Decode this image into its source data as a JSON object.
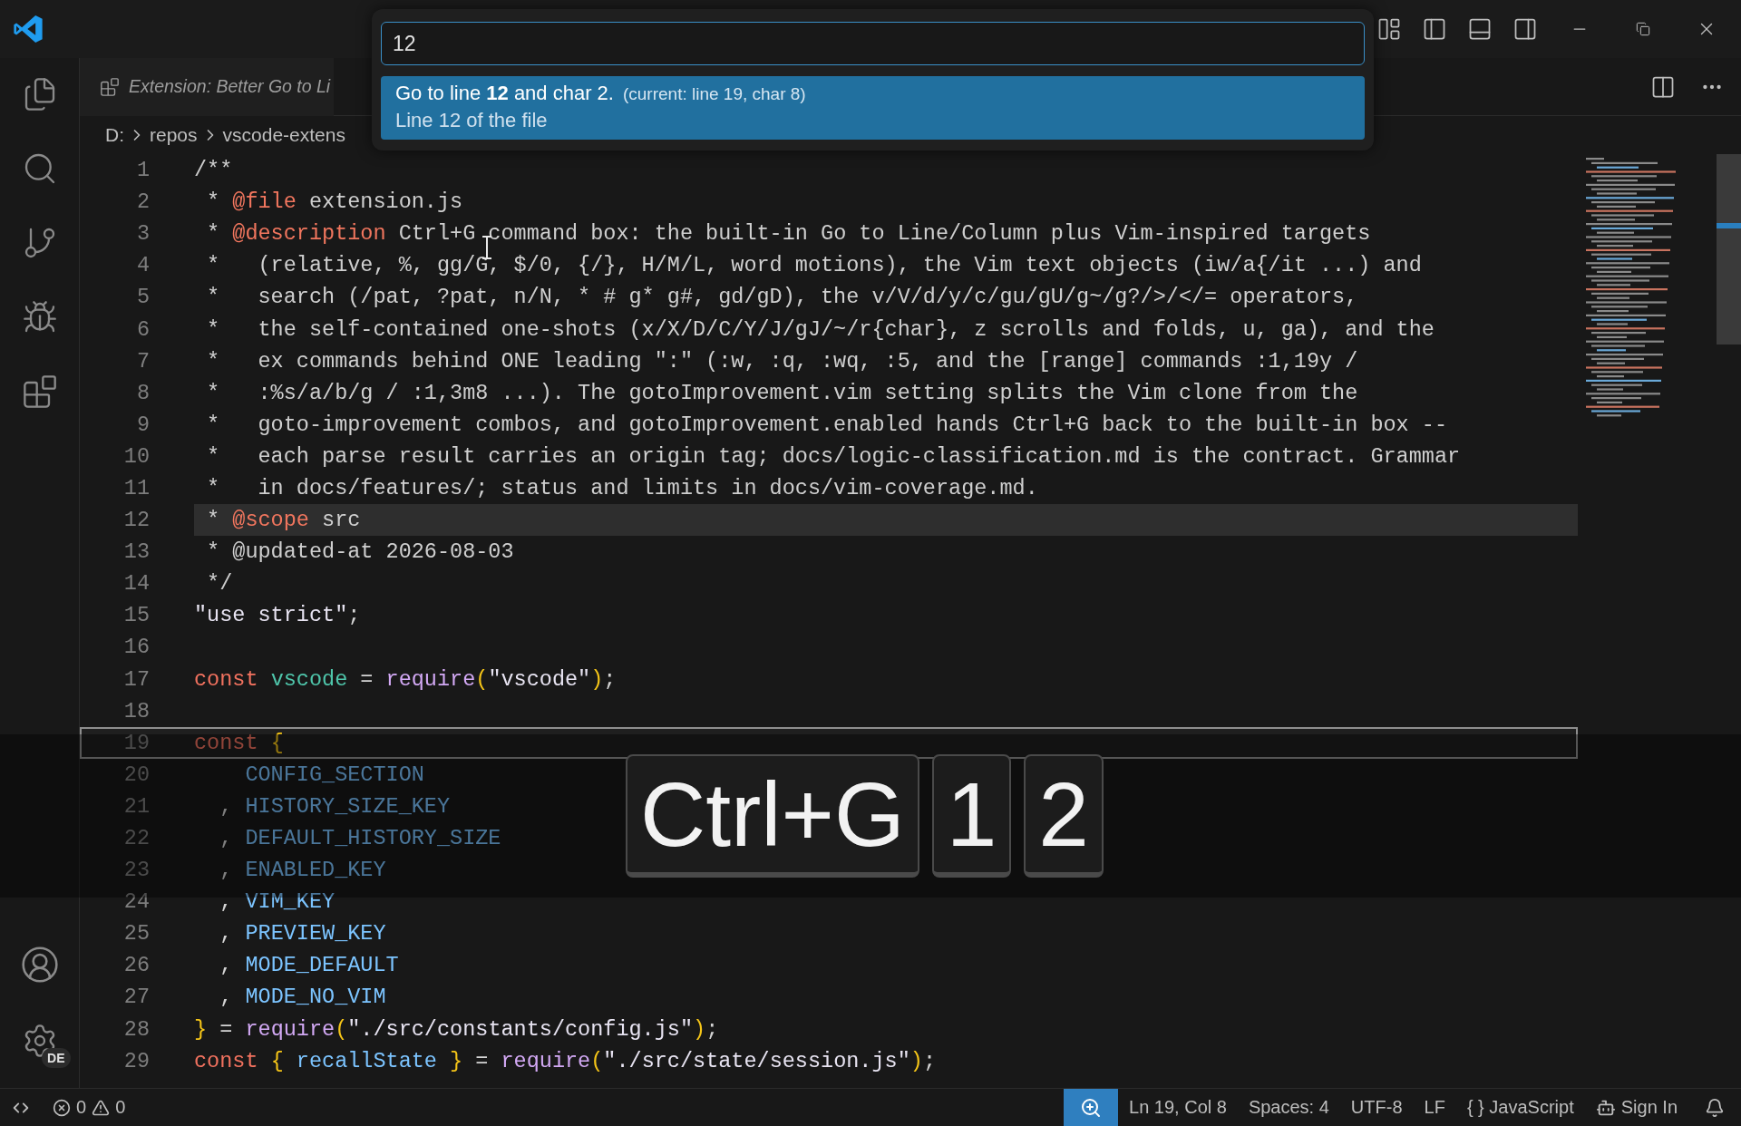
{
  "activity_bar": {
    "account_badge": "DE"
  },
  "tab": {
    "title": "Extension: Better Go to Li"
  },
  "breadcrumb": [
    "D:",
    "repos",
    "vscode-extens"
  ],
  "quick_input": {
    "value": "12",
    "items": [
      {
        "label": "Go to line **12** and char 2.",
        "detail": "(current: line 19, char 8)",
        "description": "Line 12 of the file",
        "selected": true
      }
    ]
  },
  "editor": {
    "lines": [
      {
        "number": "1",
        "highlighted": false,
        "cursor": false,
        "tokens": [
          {
            "kind": "comment",
            "text": "/**"
          }
        ]
      },
      {
        "number": "2",
        "highlighted": false,
        "cursor": false,
        "tokens": [
          {
            "kind": "comment",
            "text": " * "
          },
          {
            "kind": "tag",
            "text": "@file"
          },
          {
            "kind": "comment",
            "text": " extension.js"
          }
        ]
      },
      {
        "number": "3",
        "highlighted": false,
        "cursor": false,
        "tokens": [
          {
            "kind": "comment",
            "text": " * "
          },
          {
            "kind": "tag",
            "text": "@description"
          },
          {
            "kind": "comment",
            "text": " Ctrl+G command box: the built-in Go to Line/Column plus Vim-inspired targets"
          }
        ]
      },
      {
        "number": "4",
        "highlighted": false,
        "cursor": false,
        "tokens": [
          {
            "kind": "comment",
            "text": " *   (relative, %, gg/G, $/0, {/}, H/M/L, word motions), the Vim text objects (iw/a{/it ...) and"
          }
        ]
      },
      {
        "number": "5",
        "highlighted": false,
        "cursor": false,
        "tokens": [
          {
            "kind": "comment",
            "text": " *   search (/pat, ?pat, n/N, * # g* g#, gd/gD), the v/V/d/y/c/gu/gU/g~/g?/>/</= operators,"
          }
        ]
      },
      {
        "number": "6",
        "highlighted": false,
        "cursor": false,
        "tokens": [
          {
            "kind": "comment",
            "text": " *   the self-contained one-shots (x/X/D/C/Y/J/gJ/~/r{char}, z scrolls and folds, u, ga), and the"
          }
        ]
      },
      {
        "number": "7",
        "highlighted": false,
        "cursor": false,
        "tokens": [
          {
            "kind": "comment",
            "text": " *   ex commands behind ONE leading \":\" (:w, :q, :wq, :5, and the [range] commands :1,19y /"
          }
        ]
      },
      {
        "number": "8",
        "highlighted": false,
        "cursor": false,
        "tokens": [
          {
            "kind": "comment",
            "text": " *   :%s/a/b/g / :1,3m8 ...). The gotoImprovement.vim setting splits the Vim clone from the"
          }
        ]
      },
      {
        "number": "9",
        "highlighted": false,
        "cursor": false,
        "tokens": [
          {
            "kind": "comment",
            "text": " *   goto-improvement combos, and gotoImprovement.enabled hands Ctrl+G back to the built-in box --"
          }
        ]
      },
      {
        "number": "10",
        "highlighted": false,
        "cursor": false,
        "tokens": [
          {
            "kind": "comment",
            "text": " *   each parse result carries an origin tag; docs/logic-classification.md is the contract. Grammar"
          }
        ]
      },
      {
        "number": "11",
        "highlighted": false,
        "cursor": false,
        "tokens": [
          {
            "kind": "comment",
            "text": " *   in docs/features/; status and limits in docs/vim-coverage.md."
          }
        ]
      },
      {
        "number": "12",
        "highlighted": true,
        "cursor": false,
        "tokens": [
          {
            "kind": "comment",
            "text": " * "
          },
          {
            "kind": "tag",
            "text": "@scope"
          },
          {
            "kind": "comment",
            "text": " src"
          }
        ]
      },
      {
        "number": "13",
        "highlighted": false,
        "cursor": false,
        "tokens": [
          {
            "kind": "comment",
            "text": " * @updated-at 2026-08-03"
          }
        ]
      },
      {
        "number": "14",
        "highlighted": false,
        "cursor": false,
        "tokens": [
          {
            "kind": "comment",
            "text": " */"
          }
        ]
      },
      {
        "number": "15",
        "highlighted": false,
        "cursor": false,
        "tokens": [
          {
            "kind": "string",
            "text": "\"use strict\""
          },
          {
            "kind": "punct",
            "text": ";"
          }
        ]
      },
      {
        "number": "16",
        "highlighted": false,
        "cursor": false
      },
      {
        "number": "17",
        "highlighted": false,
        "cursor": false,
        "tokens": [
          {
            "kind": "keyword",
            "text": "const "
          },
          {
            "kind": "variable",
            "text": "vscode"
          },
          {
            "kind": "punct",
            "text": " = "
          },
          {
            "kind": "function",
            "text": "require"
          },
          {
            "kind": "brace",
            "text": "("
          },
          {
            "kind": "string",
            "text": "\"vscode\""
          },
          {
            "kind": "brace",
            "text": ")"
          },
          {
            "kind": "punct",
            "text": ";"
          }
        ]
      },
      {
        "number": "18",
        "highlighted": false,
        "cursor": false
      },
      {
        "number": "19",
        "highlighted": false,
        "cursor": true,
        "tokens": [
          {
            "kind": "keyword",
            "text": "const "
          },
          {
            "kind": "brace",
            "text": "{"
          }
        ]
      },
      {
        "number": "20",
        "highlighted": false,
        "cursor": false,
        "tokens": [
          {
            "kind": "constant",
            "text": "    CONFIG_SECTION"
          }
        ]
      },
      {
        "number": "21",
        "highlighted": false,
        "cursor": false,
        "tokens": [
          {
            "kind": "punct",
            "text": "  , "
          },
          {
            "kind": "constant",
            "text": "HISTORY_SIZE_KEY"
          }
        ]
      },
      {
        "number": "22",
        "highlighted": false,
        "cursor": false,
        "tokens": [
          {
            "kind": "punct",
            "text": "  , "
          },
          {
            "kind": "constant",
            "text": "DEFAULT_HISTORY_SIZE"
          }
        ]
      },
      {
        "number": "23",
        "highlighted": false,
        "cursor": false,
        "tokens": [
          {
            "kind": "punct",
            "text": "  , "
          },
          {
            "kind": "constant",
            "text": "ENABLED_KEY"
          }
        ]
      },
      {
        "number": "24",
        "highlighted": false,
        "cursor": false,
        "tokens": [
          {
            "kind": "punct",
            "text": "  , "
          },
          {
            "kind": "constant",
            "text": "VIM_KEY"
          }
        ]
      },
      {
        "number": "25",
        "highlighted": false,
        "cursor": false,
        "tokens": [
          {
            "kind": "punct",
            "text": "  , "
          },
          {
            "kind": "constant",
            "text": "PREVIEW_KEY"
          }
        ]
      },
      {
        "number": "26",
        "highlighted": false,
        "cursor": false,
        "tokens": [
          {
            "kind": "punct",
            "text": "  , "
          },
          {
            "kind": "constant",
            "text": "MODE_DEFAULT"
          }
        ]
      },
      {
        "number": "27",
        "highlighted": false,
        "cursor": false,
        "tokens": [
          {
            "kind": "punct",
            "text": "  , "
          },
          {
            "kind": "constant",
            "text": "MODE_NO_VIM"
          }
        ]
      },
      {
        "number": "28",
        "highlighted": false,
        "cursor": false,
        "tokens": [
          {
            "kind": "brace",
            "text": "}"
          },
          {
            "kind": "punct",
            "text": " = "
          },
          {
            "kind": "function",
            "text": "require"
          },
          {
            "kind": "brace",
            "text": "("
          },
          {
            "kind": "string",
            "text": "\"./src/constants/config.js\""
          },
          {
            "kind": "brace",
            "text": ")"
          },
          {
            "kind": "punct",
            "text": ";"
          }
        ]
      },
      {
        "number": "29",
        "highlighted": false,
        "cursor": false,
        "tokens": [
          {
            "kind": "keyword",
            "text": "const "
          },
          {
            "kind": "brace",
            "text": "{"
          },
          {
            "kind": "constant",
            "text": " recallState "
          },
          {
            "kind": "brace",
            "text": "}"
          },
          {
            "kind": "punct",
            "text": " = "
          },
          {
            "kind": "function",
            "text": "require"
          },
          {
            "kind": "brace",
            "text": "("
          },
          {
            "kind": "string",
            "text": "\"./src/state/session.js\""
          },
          {
            "kind": "brace",
            "text": ")"
          },
          {
            "kind": "punct",
            "text": ";"
          }
        ]
      }
    ]
  },
  "keycast": [
    "Ctrl+G",
    "1",
    "2"
  ],
  "status_bar": {
    "errors": "0",
    "warnings": "0",
    "position": "Ln 19, Col 8",
    "indentation": "Spaces: 4",
    "encoding": "UTF-8",
    "line_ending": "LF",
    "language_icon": "{ }",
    "language": "JavaScript",
    "account": "Sign In"
  }
}
